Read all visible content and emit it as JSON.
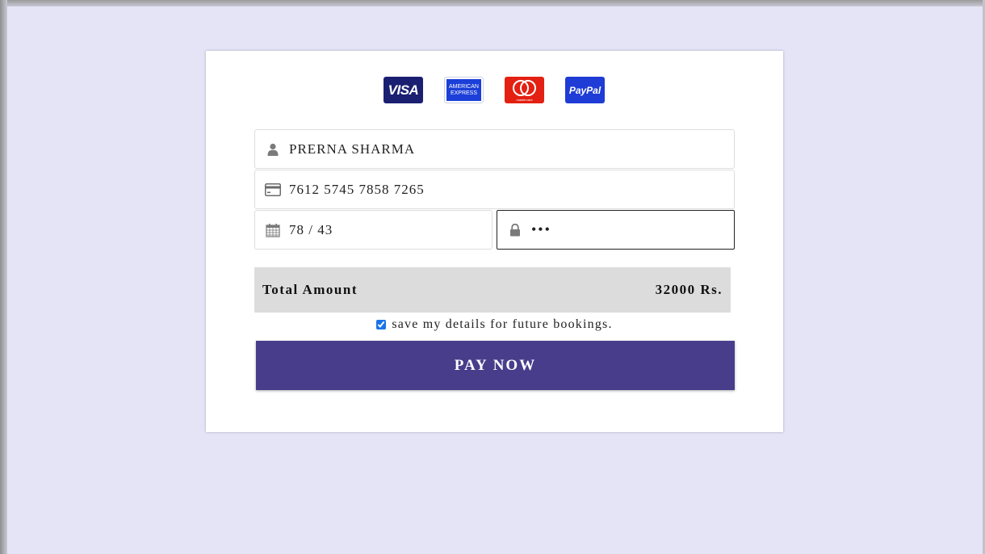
{
  "payment_logos": {
    "visa": "VISA",
    "amex_line1": "AMERICAN",
    "amex_line2": "EXPRESS",
    "mastercard_text": "mastercard",
    "paypal": "PayPal"
  },
  "form": {
    "name_value": "PRERNA SHARMA",
    "card_number_value": "7612 5745 7858 7265",
    "expiry_value": "78 / 43",
    "cvv_value": "•••"
  },
  "icons": {
    "name_field": "user-icon",
    "card_field": "credit-card-icon",
    "expiry_field": "calendar-icon",
    "cvv_field": "lock-icon"
  },
  "summary": {
    "total_label": "Total Amount",
    "total_value": "32000 Rs."
  },
  "save_details": {
    "label": "save my details for future bookings.",
    "checked": true
  },
  "pay_button_label": "PAY NOW",
  "colors": {
    "page_background": "#e4e4f6",
    "pay_button": "#483d8b",
    "summary_bar": "#dcdcdc"
  }
}
